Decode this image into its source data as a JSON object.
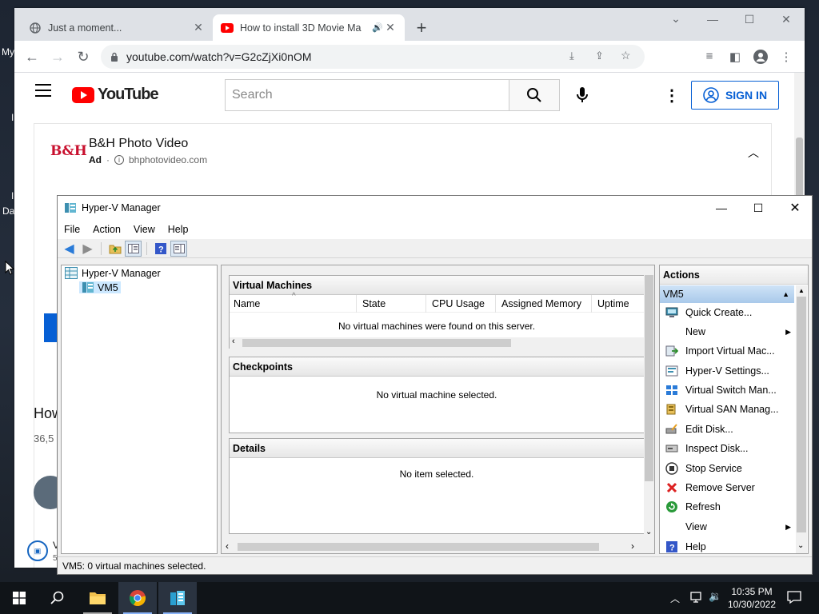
{
  "desktop": {
    "partial_texts": [
      "My",
      "I",
      "Da"
    ]
  },
  "chrome": {
    "tabs": [
      {
        "title": "Just a moment...",
        "icon": "globe-icon",
        "active": false
      },
      {
        "title": "How to install 3D Movie Ma",
        "icon": "youtube-icon",
        "active": true
      }
    ],
    "new_tab_label": "+",
    "url": "youtube.com/watch?v=G2cZjXi0nOM"
  },
  "youtube": {
    "logo_text": "YouTube",
    "search_placeholder": "Search",
    "sign_in_label": "SIGN IN",
    "ad": {
      "advertiser": "B&H Photo Video",
      "ad_label": "Ad",
      "domain": "bhphotovideo.com",
      "logo_text": "B&H"
    },
    "partial_title": "How",
    "partial_views": "36,5",
    "partial_channel": "V",
    "partial_sub": "5"
  },
  "hyperv": {
    "title": "Hyper-V Manager",
    "menu": [
      "File",
      "Action",
      "View",
      "Help"
    ],
    "tree": {
      "root": "Hyper-V Manager",
      "server": "VM5"
    },
    "vm_panel": {
      "title": "Virtual Machines",
      "columns": [
        "Name",
        "State",
        "CPU Usage",
        "Assigned Memory",
        "Uptime"
      ],
      "empty_message": "No virtual machines were found on this server."
    },
    "checkpoints": {
      "title": "Checkpoints",
      "message": "No virtual machine selected."
    },
    "details": {
      "title": "Details",
      "message": "No item selected."
    },
    "actions": {
      "header": "Actions",
      "group": "VM5",
      "items": [
        {
          "label": "Quick Create...",
          "icon": "monitor-icon"
        },
        {
          "label": "New",
          "icon": "",
          "submenu": true
        },
        {
          "label": "Import Virtual Mac...",
          "icon": "import-icon"
        },
        {
          "label": "Hyper-V Settings...",
          "icon": "settings-icon"
        },
        {
          "label": "Virtual Switch Man...",
          "icon": "network-switch-icon"
        },
        {
          "label": "Virtual SAN Manag...",
          "icon": "san-icon"
        },
        {
          "label": "Edit Disk...",
          "icon": "edit-disk-icon"
        },
        {
          "label": "Inspect Disk...",
          "icon": "inspect-disk-icon"
        },
        {
          "label": "Stop Service",
          "icon": "stop-icon"
        },
        {
          "label": "Remove Server",
          "icon": "remove-icon"
        },
        {
          "label": "Refresh",
          "icon": "refresh-icon"
        },
        {
          "label": "View",
          "icon": "",
          "submenu": true
        },
        {
          "label": "Help",
          "icon": "help-icon"
        }
      ]
    },
    "status": "VM5:  0 virtual machines selected."
  },
  "taskbar": {
    "time": "10:35 PM",
    "date": "10/30/2022",
    "apps": [
      "file-explorer-icon",
      "chrome-icon",
      "hyper-v-manager-icon"
    ]
  },
  "colors": {
    "youtube_red": "#ff0000",
    "signin_blue": "#065fd4",
    "selection": "#cce8ff"
  }
}
